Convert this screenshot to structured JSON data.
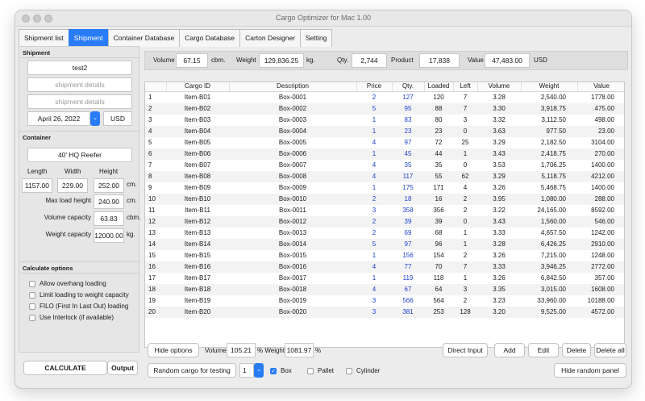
{
  "window": {
    "title": "Cargo Optimizer for Mac 1.00"
  },
  "tabs": [
    {
      "label": "Shipment list",
      "active": false
    },
    {
      "label": "Shipment",
      "active": true
    },
    {
      "label": "Container Database",
      "active": false
    },
    {
      "label": "Cargo Database",
      "active": false
    },
    {
      "label": "Carton Designer",
      "active": false
    },
    {
      "label": "Setting",
      "active": false
    }
  ],
  "shipment": {
    "heading": "Shipment",
    "name": "test2",
    "details1_placeholder": "shipment details",
    "details2_placeholder": "shipment details",
    "date": "April 26, 2022",
    "currency": "USD"
  },
  "container": {
    "heading": "Container",
    "type": "40' HQ Reefer",
    "length_label": "Length",
    "width_label": "Width",
    "height_label": "Height",
    "length": "1157.00",
    "width": "229.00",
    "height": "252.00",
    "dim_unit": "cm.",
    "max_load_height_label": "Max load height",
    "max_load_height": "240.90",
    "max_load_unit": "cm.",
    "volume_capacity_label": "Volume capacity",
    "volume_capacity": "63.83",
    "volume_unit": "cbm.",
    "weight_capacity_label": "Weight capacity",
    "weight_capacity": "12000.00",
    "weight_unit": "kg."
  },
  "calc_options": {
    "heading": "Calculate options",
    "items": [
      {
        "label": "Allow overhang loading",
        "checked": false
      },
      {
        "label": "Limit loading to weight capacity",
        "checked": false
      },
      {
        "label": "FILO (First In Last Out) loading",
        "checked": false
      },
      {
        "label": "Use Interlock (if available)",
        "checked": false
      }
    ]
  },
  "left_buttons": {
    "calculate": "CALCULATE",
    "output": "Output"
  },
  "stats": {
    "volume_label": "Volume",
    "volume": "67.15",
    "volume_unit": "cbm.",
    "weight_label": "Weight",
    "weight": "129,836.25",
    "weight_unit": "kg.",
    "qty_label": "Qty.",
    "qty": "2,744",
    "product_label": "Product",
    "product": "17,838",
    "value_label": "Value",
    "value": "47,483.00",
    "value_unit": "USD"
  },
  "table": {
    "columns": [
      "",
      "Cargo ID",
      "Description",
      "Price",
      "Qty.",
      "Loaded",
      "Left",
      "Volume",
      "Weight",
      "Value"
    ],
    "rows": [
      [
        "1",
        "Item-B01",
        "Box-0001",
        "2",
        "127",
        "120",
        "7",
        "3.28",
        "2,540.00",
        "1778.00"
      ],
      [
        "2",
        "Item-B02",
        "Box-0002",
        "5",
        "95",
        "88",
        "7",
        "3.30",
        "3,918.75",
        "475.00"
      ],
      [
        "3",
        "Item-B03",
        "Box-0003",
        "1",
        "83",
        "80",
        "3",
        "3.32",
        "3,112.50",
        "498.00"
      ],
      [
        "4",
        "Item-B04",
        "Box-0004",
        "1",
        "23",
        "23",
        "0",
        "3.63",
        "977.50",
        "23.00"
      ],
      [
        "5",
        "Item-B05",
        "Box-0005",
        "4",
        "97",
        "72",
        "25",
        "3.29",
        "2,182.50",
        "3104.00"
      ],
      [
        "6",
        "Item-B06",
        "Box-0006",
        "1",
        "45",
        "44",
        "1",
        "3.43",
        "2,418.75",
        "270.00"
      ],
      [
        "7",
        "Item-B07",
        "Box-0007",
        "4",
        "35",
        "35",
        "0",
        "3.53",
        "1,706.25",
        "1400.00"
      ],
      [
        "8",
        "Item-B08",
        "Box-0008",
        "4",
        "117",
        "55",
        "62",
        "3.29",
        "5,118.75",
        "4212.00"
      ],
      [
        "9",
        "Item-B09",
        "Box-0009",
        "1",
        "175",
        "171",
        "4",
        "3.26",
        "5,468.75",
        "1400.00"
      ],
      [
        "10",
        "Item-B10",
        "Box-0010",
        "2",
        "18",
        "16",
        "2",
        "3.95",
        "1,080.00",
        "288.00"
      ],
      [
        "11",
        "Item-B11",
        "Box-0011",
        "3",
        "358",
        "356",
        "2",
        "3.22",
        "24,165.00",
        "8592.00"
      ],
      [
        "12",
        "Item-B12",
        "Box-0012",
        "2",
        "39",
        "39",
        "0",
        "3.43",
        "1,560.00",
        "546.00"
      ],
      [
        "13",
        "Item-B13",
        "Box-0013",
        "2",
        "69",
        "68",
        "1",
        "3.33",
        "4,657.50",
        "1242.00"
      ],
      [
        "14",
        "Item-B14",
        "Box-0014",
        "5",
        "97",
        "96",
        "1",
        "3.28",
        "6,426.25",
        "2910.00"
      ],
      [
        "15",
        "Item-B15",
        "Box-0015",
        "1",
        "156",
        "154",
        "2",
        "3.26",
        "7,215.00",
        "1248.00"
      ],
      [
        "16",
        "Item-B16",
        "Box-0016",
        "4",
        "77",
        "70",
        "7",
        "3.33",
        "3,946.25",
        "2772.00"
      ],
      [
        "17",
        "Item-B17",
        "Box-0017",
        "1",
        "119",
        "118",
        "1",
        "3.26",
        "6,842.50",
        "357.00"
      ],
      [
        "18",
        "Item-B18",
        "Box-0018",
        "4",
        "67",
        "64",
        "3",
        "3.35",
        "3,015.00",
        "1608.00"
      ],
      [
        "19",
        "Item-B19",
        "Box-0019",
        "3",
        "566",
        "564",
        "2",
        "3.23",
        "33,960.00",
        "10188.00"
      ],
      [
        "20",
        "Item-B20",
        "Box-0020",
        "3",
        "381",
        "253",
        "128",
        "3.20",
        "9,525.00",
        "4572.00"
      ]
    ]
  },
  "bottom": {
    "hide_options": "Hide options",
    "volume_label": "Volume",
    "volume_pct": "105.21",
    "pct_weight_label": "% Weight",
    "weight_pct": "1081.97",
    "pct": "%",
    "direct_input": "Direct Input",
    "add": "Add",
    "edit": "Edit",
    "delete": "Delete",
    "delete_all": "Delete all",
    "random_cargo": "Random cargo for testing",
    "random_count": "1",
    "box_label": "Box",
    "box_checked": true,
    "pallet_label": "Pallet",
    "pallet_checked": false,
    "cylinder_label": "Cylinder",
    "cylinder_checked": false,
    "hide_random_panel": "Hide random panel"
  },
  "colors": {
    "accent": "#2a7cf6",
    "qty_text": "#1f3fd0"
  }
}
